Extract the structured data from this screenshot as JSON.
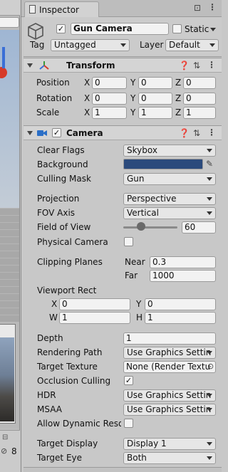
{
  "window": {
    "tab_title": "Inspector"
  },
  "gameobject": {
    "active": "✓",
    "name": "Gun Camera",
    "static_label": "Static",
    "tag_label": "Tag",
    "tag": "Untagged",
    "layer_label": "Layer",
    "layer": "Default"
  },
  "transform": {
    "title": "Transform",
    "position": {
      "label": "Position",
      "x": "0",
      "y": "0",
      "z": "0"
    },
    "rotation": {
      "label": "Rotation",
      "x": "0",
      "y": "0",
      "z": "0"
    },
    "scale": {
      "label": "Scale",
      "x": "1",
      "y": "1",
      "z": "1"
    },
    "axis": {
      "x": "X",
      "y": "Y",
      "z": "Z"
    }
  },
  "camera": {
    "enabled": "✓",
    "title": "Camera",
    "clear_flags": {
      "label": "Clear Flags",
      "value": "Skybox"
    },
    "background": {
      "label": "Background",
      "color": "#2b4a7c"
    },
    "culling_mask": {
      "label": "Culling Mask",
      "value": "Gun"
    },
    "projection": {
      "label": "Projection",
      "value": "Perspective"
    },
    "fov_axis": {
      "label": "FOV Axis",
      "value": "Vertical"
    },
    "field_of_view": {
      "label": "Field of View",
      "value": "60",
      "slider_fraction": 0.33
    },
    "physical_camera": {
      "label": "Physical Camera"
    },
    "clipping": {
      "label": "Clipping Planes",
      "near_label": "Near",
      "near": "0.3",
      "far_label": "Far",
      "far": "1000"
    },
    "viewport": {
      "label": "Viewport Rect",
      "x_label": "X",
      "x": "0",
      "y_label": "Y",
      "y": "0",
      "w_label": "W",
      "w": "1",
      "h_label": "H",
      "h": "1"
    },
    "depth": {
      "label": "Depth",
      "value": "1"
    },
    "rendering_path": {
      "label": "Rendering Path",
      "value": "Use Graphics Settin"
    },
    "target_texture": {
      "label": "Target Texture",
      "value": "None (Render Textu"
    },
    "occlusion": {
      "label": "Occlusion Culling",
      "check": "✓"
    },
    "hdr": {
      "label": "HDR",
      "value": "Use Graphics Settin"
    },
    "msaa": {
      "label": "MSAA",
      "value": "Use Graphics Settin"
    },
    "dynamic_res": {
      "label": "Allow Dynamic Resol"
    },
    "target_display": {
      "label": "Target Display",
      "value": "Display 1"
    },
    "target_eye": {
      "label": "Target Eye",
      "value": "Both"
    }
  },
  "left_panel": {
    "visibility_count": "8"
  },
  "colors": {
    "accent_blue": "#2b6fc7",
    "header": "#d4d4d4"
  }
}
